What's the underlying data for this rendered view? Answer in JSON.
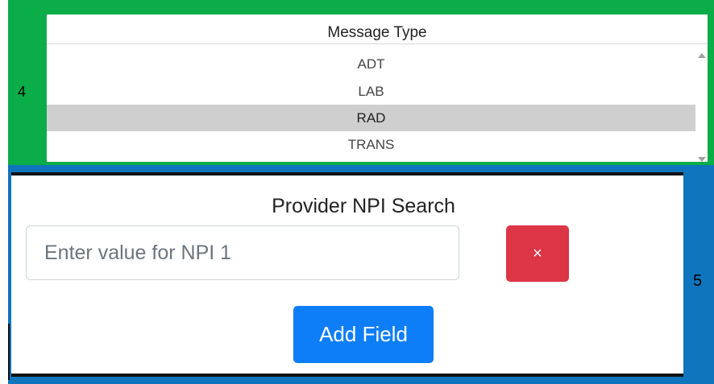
{
  "section4": {
    "number": "4",
    "message_type": {
      "title": "Message Type",
      "options": [
        "ADT",
        "LAB",
        "RAD",
        "TRANS"
      ],
      "selected": "RAD"
    }
  },
  "section5": {
    "number": "5",
    "npi_search": {
      "title": "Provider NPI Search",
      "input_placeholder": "Enter value for NPI 1",
      "input_value": "",
      "delete_label": "×",
      "add_label": "Add Field"
    }
  },
  "colors": {
    "section4_bg": "#0aad48",
    "section5_bg": "#0f75bd",
    "delete_button": "#dc3545",
    "add_button": "#0d7ef8",
    "selected_row": "#cfcfcf"
  }
}
